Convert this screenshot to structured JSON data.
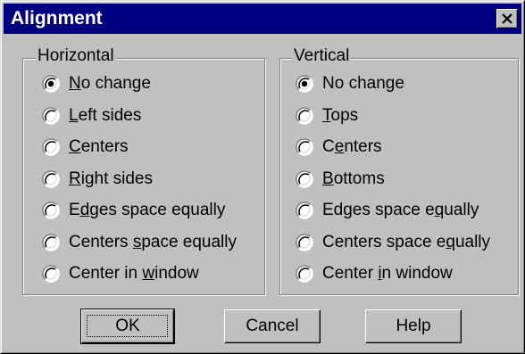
{
  "dialog": {
    "title": "Alignment",
    "close_icon": "close-icon"
  },
  "horizontal": {
    "legend": "Horizontal",
    "selected_index": 0,
    "options": [
      {
        "pre": "",
        "u": "N",
        "post": "o change"
      },
      {
        "pre": "",
        "u": "L",
        "post": "eft sides"
      },
      {
        "pre": "",
        "u": "C",
        "post": "enters"
      },
      {
        "pre": "",
        "u": "R",
        "post": "ight sides"
      },
      {
        "pre": "E",
        "u": "d",
        "post": "ges space equally"
      },
      {
        "pre": "Centers ",
        "u": "s",
        "post": "pace equally"
      },
      {
        "pre": "Center in ",
        "u": "w",
        "post": "indow"
      }
    ]
  },
  "vertical": {
    "legend": "Vertical",
    "selected_index": 0,
    "options": [
      {
        "pre": "No change",
        "u": "",
        "post": ""
      },
      {
        "pre": "",
        "u": "T",
        "post": "ops"
      },
      {
        "pre": "C",
        "u": "e",
        "post": "nters"
      },
      {
        "pre": "",
        "u": "B",
        "post": "ottoms"
      },
      {
        "pre": "Edges space e",
        "u": "q",
        "post": "ually"
      },
      {
        "pre": "Centers space e",
        "u": "q",
        "post": "ually"
      },
      {
        "pre": "Center ",
        "u": "i",
        "post": "n window"
      }
    ]
  },
  "buttons": {
    "ok": "OK",
    "cancel": "Cancel",
    "help": "Help"
  }
}
